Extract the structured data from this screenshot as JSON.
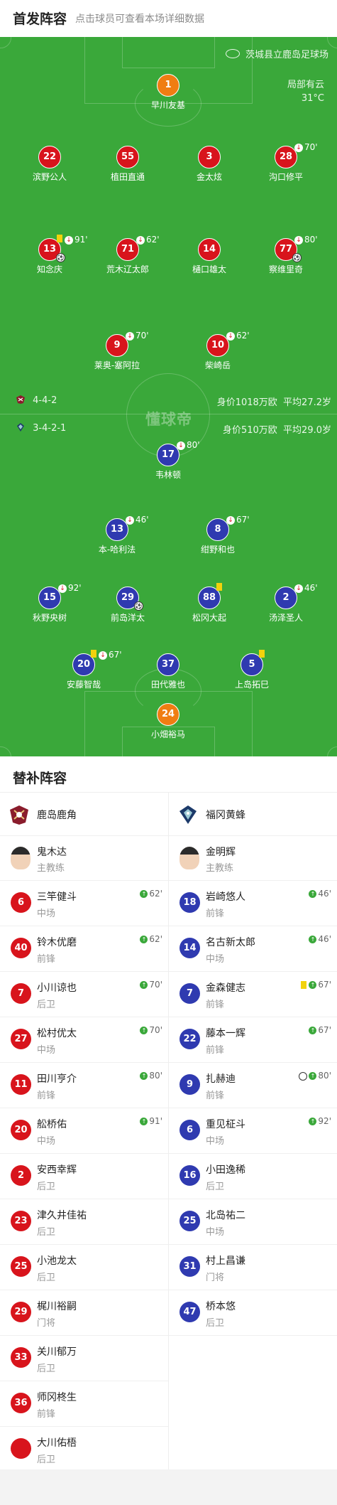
{
  "header": {
    "title": "首发阵容",
    "subtitle": "点击球员可查看本场详细数据"
  },
  "venue": "茨城县立鹿岛足球场",
  "weather": {
    "condition": "局部有云",
    "temp": "31°C"
  },
  "watermark": "懂球帝",
  "home": {
    "formation": "4-4-2",
    "value": "身价1018万欧",
    "age": "平均27.2岁"
  },
  "away": {
    "formation": "3-4-2-1",
    "value": "身价510万欧",
    "age": "平均29.0岁"
  },
  "home_xi": [
    {
      "num": "1",
      "name": "早川友基",
      "team": "gk"
    },
    {
      "num": "22",
      "name": "滨野公人",
      "team": "red"
    },
    {
      "num": "55",
      "name": "植田直通",
      "team": "red"
    },
    {
      "num": "3",
      "name": "金太炫",
      "team": "red"
    },
    {
      "num": "28",
      "name": "沟口修平",
      "team": "red",
      "sub": "70'"
    },
    {
      "num": "13",
      "name": "知念庆",
      "team": "red",
      "sub": "91'",
      "card": "yellow",
      "goal": true
    },
    {
      "num": "71",
      "name": "荒木辽太郎",
      "team": "red",
      "sub": "62'"
    },
    {
      "num": "14",
      "name": "樋口雄太",
      "team": "red"
    },
    {
      "num": "77",
      "name": "察维里奇",
      "team": "red",
      "sub": "80'",
      "goal": true
    },
    {
      "num": "9",
      "name": "莱奥-塞阿拉",
      "team": "red",
      "sub": "70'"
    },
    {
      "num": "10",
      "name": "柴崎岳",
      "team": "red",
      "sub": "62'"
    }
  ],
  "away_xi": [
    {
      "num": "17",
      "name": "韦林顿",
      "team": "blue",
      "sub": "80'"
    },
    {
      "num": "13",
      "name": "本-哈利法",
      "team": "blue",
      "sub": "46'"
    },
    {
      "num": "8",
      "name": "绀野和也",
      "team": "blue",
      "sub": "67'"
    },
    {
      "num": "15",
      "name": "秋野央树",
      "team": "blue",
      "sub": "92'"
    },
    {
      "num": "29",
      "name": "前岛洋太",
      "team": "blue",
      "goal": true
    },
    {
      "num": "88",
      "name": "松冈大起",
      "team": "blue",
      "card": "yellow"
    },
    {
      "num": "2",
      "name": "汤泽圣人",
      "team": "blue",
      "sub": "46'"
    },
    {
      "num": "20",
      "name": "安藤智哉",
      "team": "blue",
      "sub": "67'",
      "card": "yellow"
    },
    {
      "num": "37",
      "name": "田代雅也",
      "team": "blue"
    },
    {
      "num": "5",
      "name": "上岛拓巳",
      "team": "blue",
      "card": "yellow"
    },
    {
      "num": "24",
      "name": "小畑裕马",
      "team": "gk"
    }
  ],
  "subs": {
    "title": "替补阵容",
    "home_team": "鹿岛鹿角",
    "away_team": "福冈黄蜂",
    "home_coach": {
      "name": "鬼木达",
      "role": "主教练"
    },
    "away_coach": {
      "name": "金明辉",
      "role": "主教练"
    },
    "home": [
      {
        "num": "6",
        "name": "三竿健斗",
        "pos": "中场",
        "in": "62'"
      },
      {
        "num": "40",
        "name": "铃木优磨",
        "pos": "前锋",
        "in": "62'"
      },
      {
        "num": "7",
        "name": "小川谅也",
        "pos": "后卫",
        "in": "70'"
      },
      {
        "num": "27",
        "name": "松村优太",
        "pos": "中场",
        "in": "70'"
      },
      {
        "num": "11",
        "name": "田川亨介",
        "pos": "前锋",
        "in": "80'"
      },
      {
        "num": "20",
        "name": "舩桥佑",
        "pos": "中场",
        "in": "91'"
      },
      {
        "num": "2",
        "name": "安西幸辉",
        "pos": "后卫"
      },
      {
        "num": "23",
        "name": "津久井佳祐",
        "pos": "后卫"
      },
      {
        "num": "25",
        "name": "小池龙太",
        "pos": "后卫"
      },
      {
        "num": "29",
        "name": "梶川裕嗣",
        "pos": "门将"
      },
      {
        "num": "33",
        "name": "关川郁万",
        "pos": "后卫"
      },
      {
        "num": "36",
        "name": "师冈柊生",
        "pos": "前锋"
      },
      {
        "num": "",
        "name": "大川佑梧",
        "pos": "后卫"
      }
    ],
    "away": [
      {
        "num": "18",
        "name": "岩崎悠人",
        "pos": "前锋",
        "in": "46'"
      },
      {
        "num": "14",
        "name": "名古新太郎",
        "pos": "中场",
        "in": "46'"
      },
      {
        "num": "7",
        "name": "金森健志",
        "pos": "前锋",
        "in": "67'",
        "card": "yellow"
      },
      {
        "num": "22",
        "name": "藤本一辉",
        "pos": "前锋",
        "in": "67'"
      },
      {
        "num": "9",
        "name": "扎赫迪",
        "pos": "前锋",
        "in": "80'",
        "goal": true
      },
      {
        "num": "6",
        "name": "重见柾斗",
        "pos": "中场",
        "in": "92'"
      },
      {
        "num": "16",
        "name": "小田逸稀",
        "pos": "后卫"
      },
      {
        "num": "25",
        "name": "北岛祐二",
        "pos": "中场"
      },
      {
        "num": "31",
        "name": "村上昌谦",
        "pos": "门将"
      },
      {
        "num": "47",
        "name": "桥本悠",
        "pos": "后卫"
      }
    ]
  }
}
